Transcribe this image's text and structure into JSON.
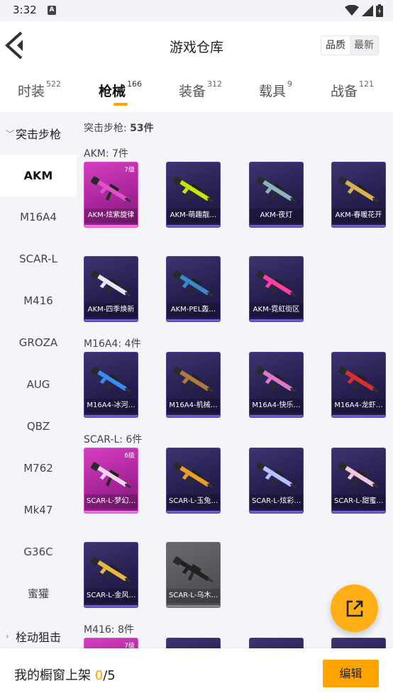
{
  "status_bar": {
    "time": "3:32",
    "notification_badge": "A"
  },
  "header": {
    "title": "游戏仓库",
    "sort_options": [
      "品质",
      "最新"
    ]
  },
  "tabs": [
    {
      "label": "时装",
      "count": "522"
    },
    {
      "label": "枪械",
      "count": "166",
      "active": true
    },
    {
      "label": "装备",
      "count": "312"
    },
    {
      "label": "载具",
      "count": "9"
    },
    {
      "label": "战备",
      "count": "121"
    }
  ],
  "sidebar": {
    "group_open": "突击步枪",
    "items": [
      "AKM",
      "M16A4",
      "SCAR-L",
      "M416",
      "GROZA",
      "AUG",
      "QBZ",
      "M762",
      "Mk47",
      "G36C",
      "蜜獾"
    ],
    "active_item": "AKM",
    "group_next": "栓动狙击"
  },
  "content": {
    "summary_label": "突击步枪:",
    "summary_count": "53件",
    "sections": [
      {
        "label": "AKM:",
        "count": "7件",
        "items": [
          {
            "name": "AKM-炫紫旋律",
            "rarity": "pink",
            "level": "7级",
            "accent": "#e052cc"
          },
          {
            "name": "AKM-萌趣靓…",
            "rarity": "purple",
            "accent": "#c8e600"
          },
          {
            "name": "AKM-夜灯",
            "rarity": "purple",
            "accent": "#8db5b8"
          },
          {
            "name": "AKM-春暖花开",
            "rarity": "purple",
            "accent": "#d8b050"
          },
          {
            "name": "AKM-四季焕新",
            "rarity": "purple",
            "accent": "#e8e8f0"
          },
          {
            "name": "AKM-PEL轰…",
            "rarity": "purple",
            "accent": "#3d88c8"
          },
          {
            "name": "AKM-霓虹街区",
            "rarity": "purple",
            "accent": "#ff3ea0"
          }
        ]
      },
      {
        "label": "M16A4:",
        "count": "4件",
        "items": [
          {
            "name": "M16A4-冰河…",
            "rarity": "purple",
            "accent": "#3a8cf0"
          },
          {
            "name": "M16A4-机械…",
            "rarity": "purple",
            "accent": "#b07a3c"
          },
          {
            "name": "M16A4-快乐…",
            "rarity": "purple",
            "accent": "#e078c8"
          },
          {
            "name": "M16A4-龙虾…",
            "rarity": "purple",
            "accent": "#d8302c"
          }
        ]
      },
      {
        "label": "SCAR-L:",
        "count": "6件",
        "items": [
          {
            "name": "SCAR-L-梦幻…",
            "rarity": "pink",
            "level": "6级",
            "accent": "#f0d4f0"
          },
          {
            "name": "SCAR-L-玉兔…",
            "rarity": "purple",
            "accent": "#e8a020"
          },
          {
            "name": "SCAR-L-炫彩…",
            "rarity": "purple",
            "accent": "#b8c0ff"
          },
          {
            "name": "SCAR-L-甜蜜…",
            "rarity": "purple",
            "accent": "#f0c8d8"
          },
          {
            "name": "SCAR-L-金风…",
            "rarity": "purple",
            "accent": "#e8b840"
          },
          {
            "name": "SCAR-L-乌木…",
            "rarity": "gray",
            "accent": "#202020"
          }
        ]
      },
      {
        "label": "M416:",
        "count": "8件",
        "items": [
          {
            "name": "",
            "rarity": "pink",
            "level": "7级",
            "accent": "#e052cc"
          },
          {
            "name": "",
            "rarity": "purple",
            "accent": "#888888"
          },
          {
            "name": "",
            "rarity": "purple",
            "accent": "#888888"
          },
          {
            "name": "",
            "rarity": "purple",
            "accent": "#888888"
          }
        ]
      }
    ]
  },
  "bottom_bar": {
    "prefix": "我的橱窗上架",
    "current": "0",
    "total": "/5",
    "edit_label": "编辑"
  },
  "colors": {
    "accent": "#ffa400",
    "card_purple": "#2c2560",
    "card_pink": "#c030b0",
    "card_gray": "#5a5a5e"
  }
}
